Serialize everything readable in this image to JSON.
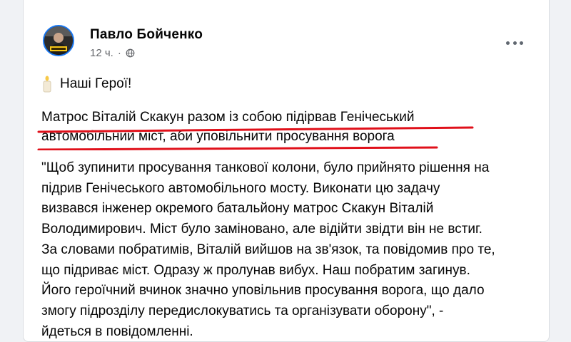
{
  "post": {
    "author": "Павло Бойченко",
    "time": "12 ч.",
    "separator": "·",
    "privacy_icon": "globe-icon",
    "more_icon": "more-options-icon",
    "hero_text": "Наші Герої!",
    "emoji_icon": "candle-icon",
    "highlight_lines": [
      "Матрос Віталій Скакун разом із собою підірвав Генічеський",
      "автомобільний міст, аби уповільнити просування ворога"
    ],
    "quote_lines": [
      "\"Щоб зупинити просування танкової колони, було прийнято рішення на",
      "підрив Генічеського автомобільного мосту. Виконати цю задачу",
      "визвався інженер окремого батальйону матрос Скакун Віталій",
      "Володимирович. Міст було заміновано, але відійти звідти він не встиг.",
      "За словами побратимів, Віталій вийшов на зв'язок, та повідомив про те,",
      "що підриває міст. Одразу ж пролунав вибух. Наш побратим загинув.",
      "Його героїчний вчинок значно уповільнив просування ворога, що дало",
      "змогу підрозділу передислокуватись та організувати оборону\", -",
      "йдеться в повідомленні."
    ]
  },
  "colors": {
    "underline": "#e0101a",
    "accent": "#1877f2",
    "secondary_text": "#65676b"
  }
}
